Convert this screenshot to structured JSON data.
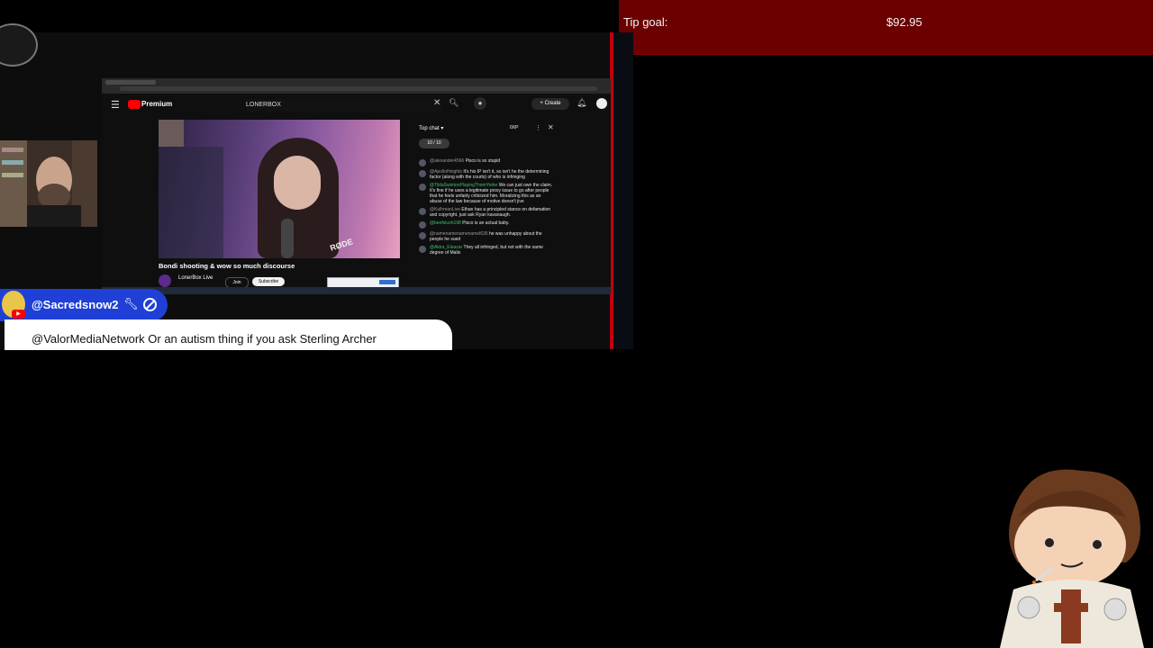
{
  "tip_goal": {
    "label": "Tip goal:",
    "amount": "$92.95"
  },
  "browser": {
    "search_value": "LONERBOX",
    "brand": "Premium",
    "create_label": "Create",
    "video_title": "Bondi shooting & wow so much discourse",
    "channel_name": "LonerBox Live",
    "join_label": "Join",
    "subscribe_label": "Subscribe",
    "mic_brand": "RØDE"
  },
  "chat": {
    "mode": "Top chat",
    "xp": "0XP",
    "pill": "10 / 10",
    "messages": [
      {
        "author": "@alexander4566",
        "text": "Pisco is so stupid",
        "green": false
      },
      {
        "author": "@ApolloHeights",
        "text": "It's his IP isn't it, so isn't he the determining factor (along with the courts) of who is infringing",
        "green": false
      },
      {
        "author": "@TildaSwintonPlayingThomYorke",
        "text": "We can just own the claim. It's fine if he uses a legitimate proxy issue to go after people that he feels unfairly criticized him. Moralizing this as an abuse of the law because of motive doesn't jive",
        "green": true
      },
      {
        "author": "@KulhmanLive",
        "text": "Ethan has a principled stance on defamation and copyright. just ask Ryan kavanaugh.",
        "green": false
      },
      {
        "author": "@beefslush198",
        "text": "Pisco is an actual baby.",
        "green": true
      },
      {
        "author": "@namenamenamenamel635",
        "text": "he was unhappy about the people he sued",
        "green": false
      },
      {
        "author": "@Akira_Eleazar",
        "text": "They all infringed, but not with the same degree of Malis",
        "green": true
      }
    ]
  },
  "overlay": {
    "username": "@Sacredsnow2",
    "message": "@ValorMediaNetwork Or an autism thing if you ask Sterling Archer"
  }
}
